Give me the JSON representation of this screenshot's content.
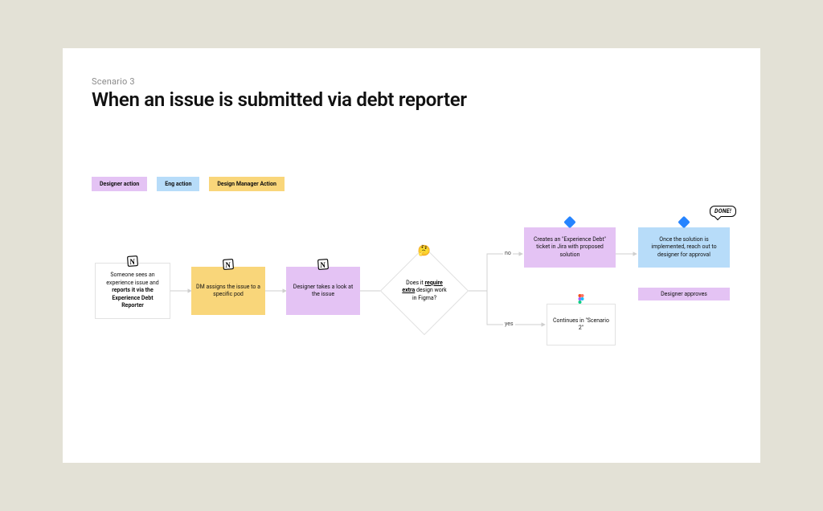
{
  "header": {
    "scenario_label": "Scenario 3",
    "title": "When an issue is submitted via debt reporter"
  },
  "legend": {
    "designer": "Designer action",
    "eng": "Eng action",
    "dm": "Design Manager Action"
  },
  "nodes": {
    "report": {
      "text_pre": "Someone sees an experience issue and ",
      "text_bold": "reports it via the Experience Debt Reporter",
      "icon": "notion"
    },
    "assign": {
      "text": "DM assigns the issue to a specific pod",
      "icon": "notion"
    },
    "look": {
      "text": "Designer takes a look at the issue",
      "icon": "notion"
    },
    "decision": {
      "text_pre": "Does it ",
      "text_bold": "require extra",
      "text_post": " design work in Figma?",
      "icon": "thinking-emoji",
      "emoji": "🤔"
    },
    "create_ticket": {
      "text": "Creates an \"Experience Debt\" ticket in Jira with proposed solution",
      "icon": "jira"
    },
    "implemented": {
      "text": "Once the solution is implemented, reach out to designer for approval",
      "icon": "jira"
    },
    "approve": {
      "text": "Designer approves"
    },
    "continue": {
      "text": "Continues in \"Scenario 2\"",
      "icon": "figma"
    },
    "done_bubble": "DONE!"
  },
  "edges": {
    "no": "no",
    "yes": "yes"
  },
  "icons": {
    "notion": "notion-icon",
    "jira": "jira-icon",
    "figma": "figma-icon",
    "thinking": "thinking-emoji"
  },
  "colors": {
    "designer": "#e4c3f4",
    "eng": "#b7dcf9",
    "dm": "#f9d67a",
    "canvas_bg": "#ffffff",
    "page_bg": "#e3e1d6"
  }
}
